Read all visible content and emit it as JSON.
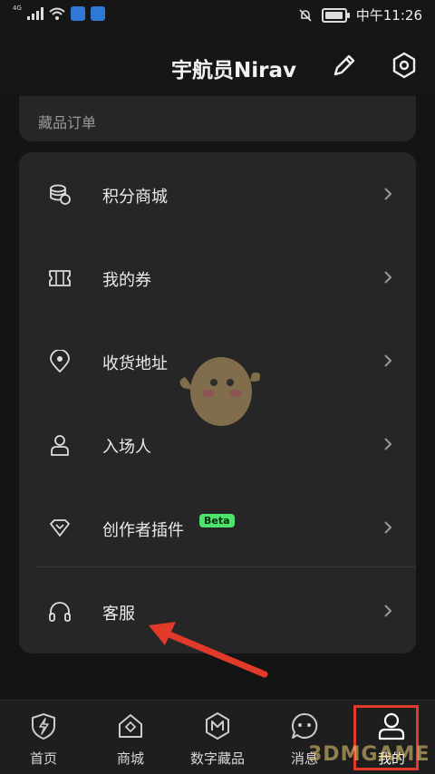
{
  "status_bar": {
    "network": "4G",
    "time": "中午11:26"
  },
  "header": {
    "username": "宇航员Nirav"
  },
  "orders": {
    "label": "藏品订单"
  },
  "menu": [
    {
      "label": "积分商城",
      "icon": "coins-icon"
    },
    {
      "label": "我的券",
      "icon": "coupon-icon"
    },
    {
      "label": "收货地址",
      "icon": "location-pin-icon"
    },
    {
      "label": "入场人",
      "icon": "person-icon"
    },
    {
      "label": "创作者插件",
      "icon": "diamond-icon",
      "badge": "Beta"
    },
    {
      "label": "客服",
      "icon": "headset-icon"
    }
  ],
  "tabs": [
    {
      "label": "首页",
      "icon": "home-shield-icon"
    },
    {
      "label": "商城",
      "icon": "shop-icon"
    },
    {
      "label": "数字藏品",
      "icon": "collection-icon"
    },
    {
      "label": "消息",
      "icon": "message-icon"
    },
    {
      "label": "我的",
      "icon": "user-icon",
      "active": true
    }
  ],
  "watermark": "3DMGAME",
  "colors": {
    "accent_beta": "#4de46c",
    "highlight": "#e23a2a",
    "card": "#262626",
    "background": "#141414"
  }
}
